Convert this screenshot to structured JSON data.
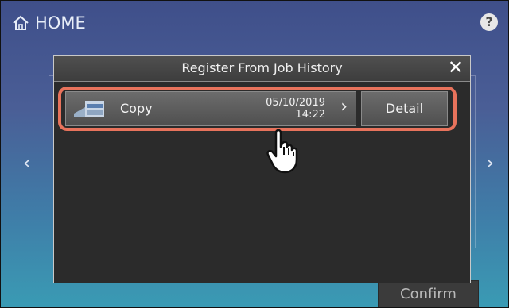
{
  "header": {
    "home_label": "HOME",
    "help_label": "?"
  },
  "nav": {
    "prev": "‹",
    "next": "›"
  },
  "dialog": {
    "title": "Register From Job History",
    "close_label": "✕",
    "rows": [
      {
        "label": "Copy",
        "date": "05/10/2019",
        "time": "14:22",
        "chevron": "›",
        "icon": "copier-icon"
      }
    ],
    "detail_label": "Detail"
  },
  "footer": {
    "confirm_label": "Confirm"
  },
  "colors": {
    "highlight": "#e8735c",
    "dialog_bg": "#2f2f2f"
  }
}
